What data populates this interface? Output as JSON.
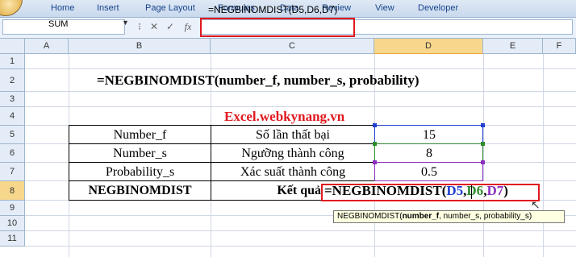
{
  "menu": [
    "Home",
    "Insert",
    "Page Layout",
    "Formulas",
    "Data",
    "Review",
    "View",
    "Developer"
  ],
  "name_box": "SUM",
  "formula_bar": {
    "fx": "fx",
    "text": "=NEGBINOMDIST(D5,D6,D7)"
  },
  "columns": [
    "A",
    "B",
    "C",
    "D",
    "E",
    "F"
  ],
  "rows": [
    "1",
    "2",
    "3",
    "4",
    "5",
    "6",
    "7",
    "8",
    "9",
    "10",
    "11"
  ],
  "cells": {
    "title": "=NEGBINOMDIST(number_f, number_s, probability)",
    "site": "Excel.webkynang.vn",
    "r5b": "Number_f",
    "r5c": "Số lần thất bại",
    "r5d": "15",
    "r6b": "Number_s",
    "r6c": "Ngưỡng thành công",
    "r6d": "8",
    "r7b": "Probability_s",
    "r7c": "Xác suất thành công",
    "r7d": "0.5",
    "r8b": "NEGBINOMDIST",
    "r8c": "Kết quả"
  },
  "edit_formula": {
    "prefix": "=NEGBINOMDIST(",
    "arg1": "D5",
    "sep1": ",",
    "arg2": "D6",
    "sep2": ",",
    "arg3": "D7",
    "suffix": ")"
  },
  "tooltip": {
    "func": "NEGBINOMDIST(",
    "bold_arg": "number_f",
    "rest": ", number_s, probability_s)"
  },
  "colors": {
    "accent_red": "#e0191f",
    "ref_blue": "#1f3fcf",
    "ref_green": "#2e8b2e",
    "ref_purple": "#8b2fbf",
    "site_red": "#e0191f"
  }
}
